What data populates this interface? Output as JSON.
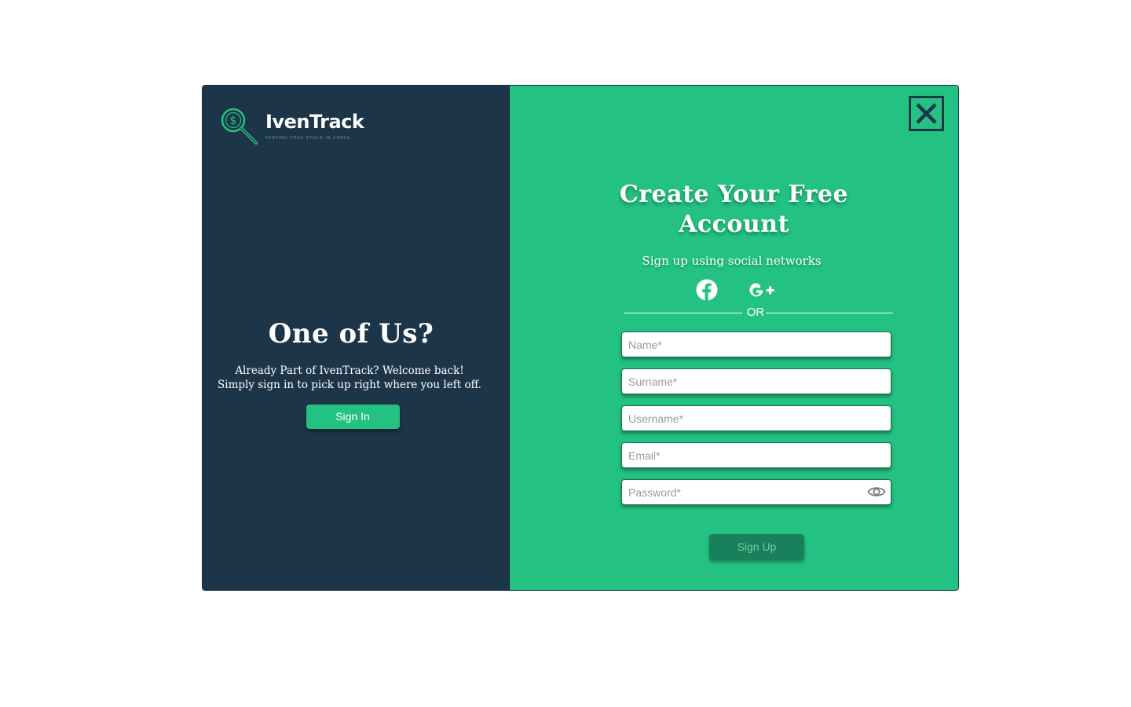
{
  "brand": {
    "name": "IvenTrack",
    "tagline": "KEEPING YOUR STOCK IN CHECK"
  },
  "left_panel": {
    "title": "One of Us?",
    "text_line1": "Already Part of IvenTrack? Welcome back!",
    "text_line2": "Simply sign in to pick up right where you left off.",
    "signin_label": "Sign In"
  },
  "right_panel": {
    "headline_line1": "Create Your Free",
    "headline_line2": "Account",
    "social_caption": "Sign up using social networks",
    "social": [
      "facebook-icon",
      "google-plus-icon"
    ],
    "divider_text": "OR",
    "fields": {
      "name": "Name*",
      "surname": "Surname*",
      "username": "Username*",
      "email": "Email*",
      "password": "Password*"
    },
    "signup_label": "Sign Up"
  },
  "colors": {
    "dark_panel": "#1d3549",
    "green_panel": "#23c282",
    "signup_button": "#19805c"
  }
}
